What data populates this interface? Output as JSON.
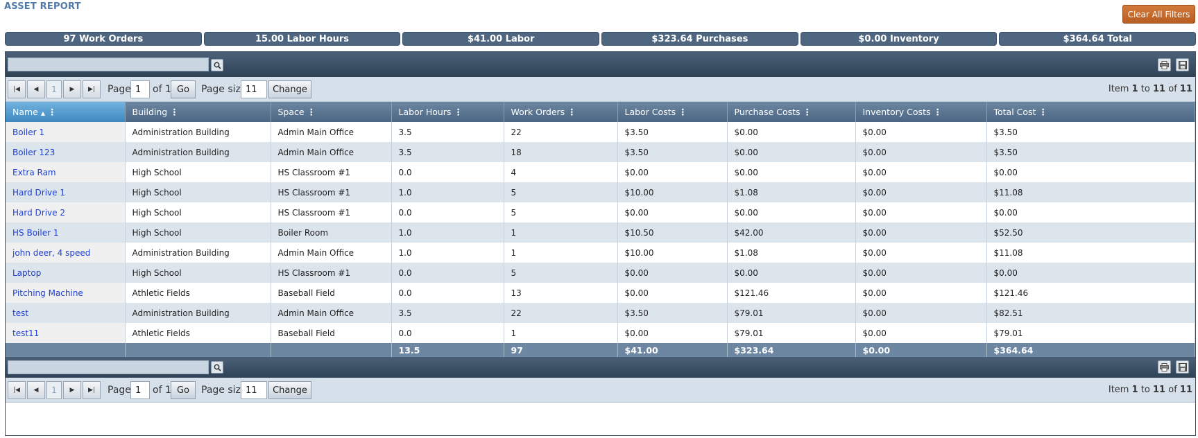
{
  "page": {
    "title": "ASSET REPORT",
    "clear_filters_label": "Clear All Filters"
  },
  "summary": [
    "97 Work Orders",
    "15.00 Labor Hours",
    "$41.00 Labor",
    "$323.64 Purchases",
    "$0.00 Inventory",
    "$364.64 Total"
  ],
  "pager": {
    "current_page_button": "1",
    "page_label": "Page:",
    "page_value": "1",
    "of_label": "of 1",
    "go_label": "Go",
    "page_size_label": "Page size:",
    "page_size_value": "11",
    "change_label": "Change",
    "item_prefix": "Item",
    "item_from": "1",
    "item_to_word": "to",
    "item_to": "11",
    "item_of_word": "of",
    "item_total": "11"
  },
  "columns": [
    "Name",
    "Building",
    "Space",
    "Labor Hours",
    "Work Orders",
    "Labor Costs",
    "Purchase Costs",
    "Inventory Costs",
    "Total Cost"
  ],
  "rows": [
    [
      "Boiler 1",
      "Administration Building",
      "Admin Main Office",
      "3.5",
      "22",
      "$3.50",
      "$0.00",
      "$0.00",
      "$3.50"
    ],
    [
      "Boiler 123",
      "Administration Building",
      "Admin Main Office",
      "3.5",
      "18",
      "$3.50",
      "$0.00",
      "$0.00",
      "$3.50"
    ],
    [
      "Extra Ram",
      "High School",
      "HS Classroom #1",
      "0.0",
      "4",
      "$0.00",
      "$0.00",
      "$0.00",
      "$0.00"
    ],
    [
      "Hard Drive 1",
      "High School",
      "HS Classroom #1",
      "1.0",
      "5",
      "$10.00",
      "$1.08",
      "$0.00",
      "$11.08"
    ],
    [
      "Hard Drive 2",
      "High School",
      "HS Classroom #1",
      "0.0",
      "5",
      "$0.00",
      "$0.00",
      "$0.00",
      "$0.00"
    ],
    [
      "HS Boiler 1",
      "High School",
      "Boiler Room",
      "1.0",
      "1",
      "$10.50",
      "$42.00",
      "$0.00",
      "$52.50"
    ],
    [
      "john deer, 4 speed",
      "Administration Building",
      "Admin Main Office",
      "1.0",
      "1",
      "$10.00",
      "$1.08",
      "$0.00",
      "$11.08"
    ],
    [
      "Laptop",
      "High School",
      "HS Classroom #1",
      "0.0",
      "5",
      "$0.00",
      "$0.00",
      "$0.00",
      "$0.00"
    ],
    [
      "Pitching Machine",
      "Athletic Fields",
      "Baseball Field",
      "0.0",
      "13",
      "$0.00",
      "$121.46",
      "$0.00",
      "$121.46"
    ],
    [
      "test",
      "Administration Building",
      "Admin Main Office",
      "3.5",
      "22",
      "$3.50",
      "$79.01",
      "$0.00",
      "$82.51"
    ],
    [
      "test11",
      "Athletic Fields",
      "Baseball Field",
      "0.0",
      "1",
      "$0.00",
      "$79.01",
      "$0.00",
      "$79.01"
    ]
  ],
  "totals": [
    "",
    "",
    "",
    "13.5",
    "97",
    "$41.00",
    "$323.64",
    "$0.00",
    "$364.64"
  ],
  "icons": {
    "search": "magnifier-icon",
    "print": "printer-icon",
    "save": "floppy-disk-icon"
  }
}
